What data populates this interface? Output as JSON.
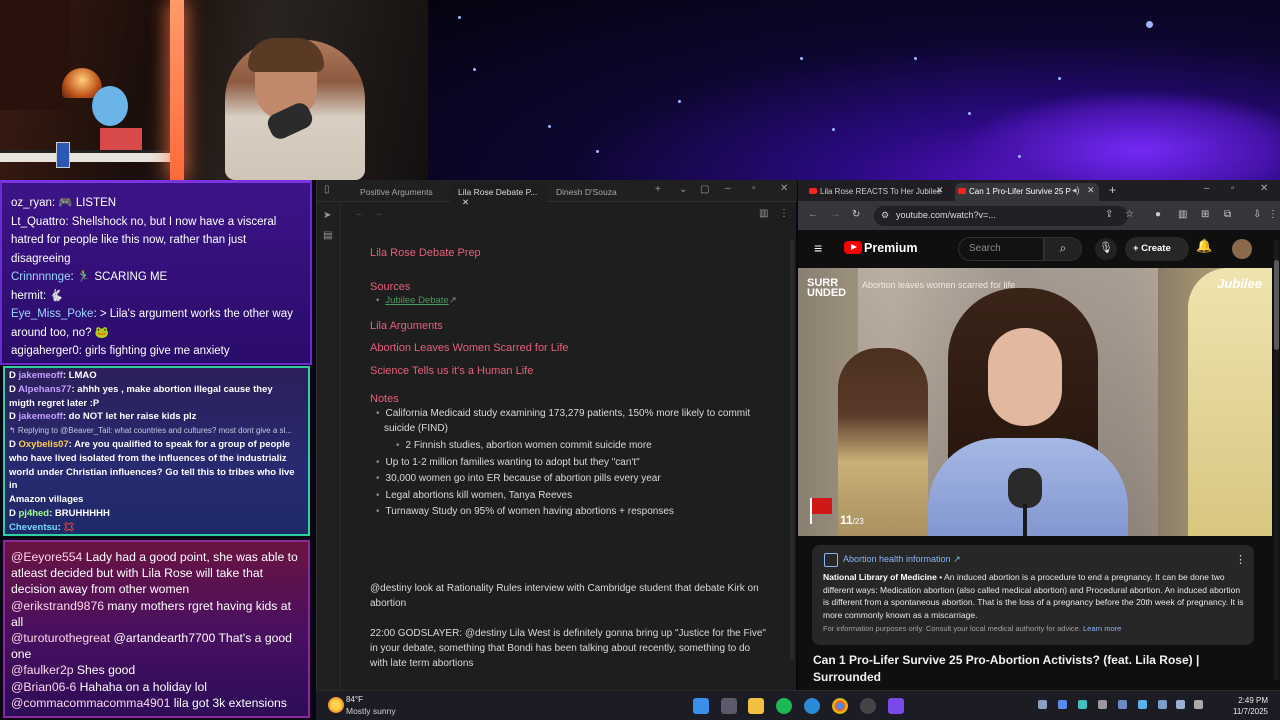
{
  "chat_top": {
    "messages": [
      {
        "user": "oz_ryan",
        "text": ": 🎮 LISTEN"
      },
      {
        "user": "Lt_Quattro",
        "text": ": Shellshock no, but I now have a visceral"
      },
      {
        "user": "",
        "text": "hatred for people like this now, rather than just"
      },
      {
        "user": "",
        "text": "disagreeing"
      },
      {
        "user": "Crinnnnnge",
        "text": ": 🏃‍♂️ SCARING ME"
      },
      {
        "user": "hermit",
        "text": ": 🐇"
      },
      {
        "user": "Eye_Miss_Poke",
        "text": ": > Lila's argument works the other way"
      },
      {
        "user": "",
        "text": "around too, no? 🐸"
      },
      {
        "user": "agigaherger0",
        "text": ": girls fighting give me anxiety"
      }
    ]
  },
  "chat_mid": {
    "messages": [
      {
        "user": "jakemeoff",
        "text": ": LMAO"
      },
      {
        "user": "Alpehans77",
        "text": ": ahhh yes , make abortion illegal cause they"
      },
      {
        "user": "",
        "text": "migth regret later :P"
      },
      {
        "user": "jakemeoff",
        "text": ": do NOT let her raise kids plz"
      },
      {
        "reply": "↰ Replying to @Beaver_Tail: what countries and cultures? most dont give a sl..."
      },
      {
        "user": "Oxybelis07",
        "text": ": Are you qualified to speak for a group of people"
      },
      {
        "user": "",
        "text": "who have lived isolated from the influences of the industrializ"
      },
      {
        "user": "",
        "text": "world under Christian influences? Go tell this to tribes who live in"
      },
      {
        "user": "",
        "text": "Amazon villages"
      },
      {
        "user": "pj4hed",
        "text": ": BRUHHHHH"
      },
      {
        "user": "Cheventsu",
        "text": ": 💢"
      }
    ]
  },
  "chat_bottom": {
    "lines": [
      {
        "at": "@Eeyore554",
        "text": " Lady had a good point, she was able to"
      },
      {
        "at": "",
        "text": "atleast decided but with Lila Rose will take that"
      },
      {
        "at": "",
        "text": "decision away from other women"
      },
      {
        "at": "@erikstrand9876",
        "text": " many mothers rgret having kids at"
      },
      {
        "at": "",
        "text": "all"
      },
      {
        "at": "@turoturothegreat",
        "text": " @artandearth7700 That's a good"
      },
      {
        "at": "",
        "text": "one"
      },
      {
        "at": "@faulker2p",
        "text": " Shes good"
      },
      {
        "at": "@Brian06-6",
        "text": " Hahaha on a holiday lol"
      },
      {
        "at": "@commacommacomma4901",
        "text": " lila got 3k extensions"
      }
    ]
  },
  "notes": {
    "tabs": [
      "Positive Arguments",
      "Lila Rose Debate P...",
      "Dinesh D'Souza"
    ],
    "title": "Lila Rose Debate Prep",
    "sources_heading": "Sources",
    "sources_link": "Jubilee Debate",
    "arguments_heading": "Lila Arguments",
    "arg1": "Abortion Leaves Women Scarred for Life",
    "arg2": "Science Tells us it's a Human Life",
    "notes_heading": "Notes",
    "bullets": [
      "California Medicaid study examining 173,279 patients, 150% more likely to commit",
      "suicide (FIND)",
      "2 Finnish studies, abortion women commit suicide more",
      "Up to 1-2 million families wanting to adopt but they \"can't\"",
      "30,000 women go into ER because of abortion pills every year",
      "Legal abortions kill women, Tanya Reeves",
      "Turnaway Study on 95% of women having abortions + responses"
    ],
    "para1": [
      "@destiny look at Rationality Rules interview with Cambridge student that debate Kirk on",
      "abortion"
    ],
    "para2": [
      "22:00 GODSLAYER: @destiny Lila West is definitely gonna bring up \"Justice for the Five\"",
      "in your debate, something that Bondi has been talking about recently, something to do",
      "with late term abortions"
    ]
  },
  "browser": {
    "tab1": "Lila Rose REACTS To Her Jubilee",
    "tab2": "Can 1 Pro-Lifer Survive 25 P",
    "url": "youtube.com/watch?v=...",
    "brand": "Premium",
    "search_placeholder": "Search",
    "create_label": "+ Create",
    "video": {
      "logo_line1": "SURR",
      "logo_line2": "UNDED",
      "caption": "Abortion leaves women scarred for life",
      "brand": "Jubilee",
      "count": "11",
      "count_total": "/23"
    },
    "info": {
      "title": "Abortion health information ↗",
      "source": "National Library of Medicine",
      "body": " • An induced abortion is a procedure to end a pregnancy. It can be done two different ways: Medication abortion (also called medical abortion) and Procedural abortion. An induced abortion is different from a spontaneous abortion. That is the loss of a pregnancy before the 20th week of pregnancy. It is more commonly known as a miscarriage.",
      "foot": "For information purposes only. Consult your local medical authority for advice.",
      "learn_more": "Learn more"
    },
    "video_title": "Can 1 Pro-Lifer Survive 25 Pro-Abortion Activists? (feat. Lila Rose) | Surrounded"
  },
  "taskbar": {
    "temp": "84°F",
    "condition": "Mostly sunny",
    "time": "2:49 PM",
    "date": "11/7/2025"
  },
  "colors": {
    "heading": "#e5607a",
    "link": "#4a9a5a",
    "yt_red": "#ff0000"
  }
}
